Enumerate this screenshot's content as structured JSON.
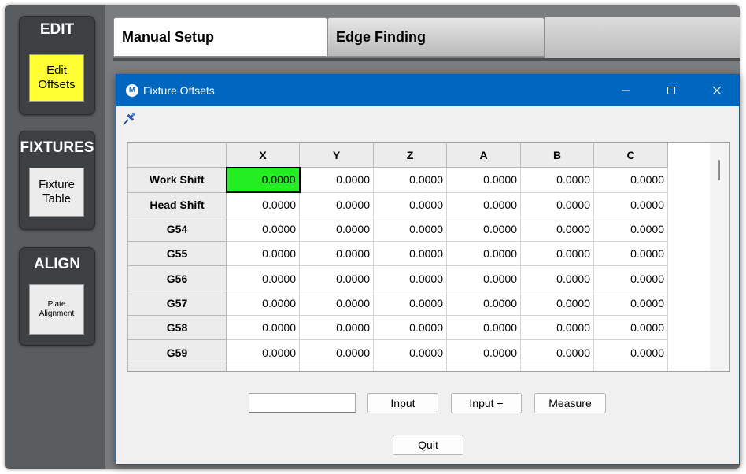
{
  "sidebar": {
    "groups": [
      {
        "title": "EDIT",
        "button_label": "Edit\nOffsets",
        "button_color": "#ffff33"
      },
      {
        "title": "FIXTURES",
        "button_label": "Fixture\nTable"
      },
      {
        "title": "ALIGN",
        "button_label": "Plate\nAlignment"
      }
    ]
  },
  "tabs": [
    {
      "label": "Manual Setup",
      "active": true
    },
    {
      "label": "Edge Finding",
      "active": false
    }
  ],
  "dialog": {
    "title": "Fixture Offsets",
    "app_icon_letter": "M",
    "icons": {
      "minimize": "minimize-icon",
      "maximize": "maximize-icon",
      "close": "close-icon",
      "pin": "pin-icon"
    },
    "accent_color": "#0067c0",
    "selected_cell_color": "#22ee22"
  },
  "grid": {
    "columns": [
      "X",
      "Y",
      "Z",
      "A",
      "B",
      "C"
    ],
    "rows": [
      {
        "label": "Work Shift",
        "values": [
          "0.0000",
          "0.0000",
          "0.0000",
          "0.0000",
          "0.0000",
          "0.0000"
        ]
      },
      {
        "label": "Head Shift",
        "values": [
          "0.0000",
          "0.0000",
          "0.0000",
          "0.0000",
          "0.0000",
          "0.0000"
        ]
      },
      {
        "label": "G54",
        "values": [
          "0.0000",
          "0.0000",
          "0.0000",
          "0.0000",
          "0.0000",
          "0.0000"
        ]
      },
      {
        "label": "G55",
        "values": [
          "0.0000",
          "0.0000",
          "0.0000",
          "0.0000",
          "0.0000",
          "0.0000"
        ]
      },
      {
        "label": "G56",
        "values": [
          "0.0000",
          "0.0000",
          "0.0000",
          "0.0000",
          "0.0000",
          "0.0000"
        ]
      },
      {
        "label": "G57",
        "values": [
          "0.0000",
          "0.0000",
          "0.0000",
          "0.0000",
          "0.0000",
          "0.0000"
        ]
      },
      {
        "label": "G58",
        "values": [
          "0.0000",
          "0.0000",
          "0.0000",
          "0.0000",
          "0.0000",
          "0.0000"
        ]
      },
      {
        "label": "G59",
        "values": [
          "0.0000",
          "0.0000",
          "0.0000",
          "0.0000",
          "0.0000",
          "0.0000"
        ]
      }
    ]
  },
  "controls": {
    "input_value": "",
    "input_label": "Input",
    "input_plus_label": "Input +",
    "measure_label": "Measure",
    "quit_label": "Quit"
  }
}
